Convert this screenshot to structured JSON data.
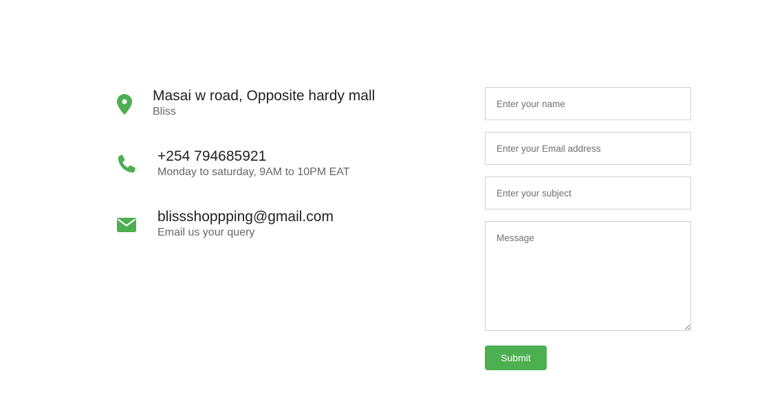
{
  "contact_info": [
    {
      "icon": "location-pin-icon",
      "title": "Masai w road, Opposite hardy mall",
      "subtitle": "Bliss"
    },
    {
      "icon": "phone-icon",
      "title": "+254 794685921",
      "subtitle": "Monday to saturday, 9AM to 10PM EAT"
    },
    {
      "icon": "envelope-icon",
      "title": "blissshoppping@gmail.com",
      "subtitle": "Email us your query"
    }
  ],
  "form": {
    "name_placeholder": "Enter your name",
    "email_placeholder": "Enter your Email address",
    "subject_placeholder": "Enter your subject",
    "message_placeholder": "Message",
    "name_value": "",
    "email_value": "",
    "subject_value": "",
    "message_value": "",
    "submit_label": "Submit"
  },
  "colors": {
    "accent": "#4caf50",
    "title_text": "#1f1f1f",
    "subtitle_text": "#666666",
    "field_border": "#cfcfcf"
  }
}
